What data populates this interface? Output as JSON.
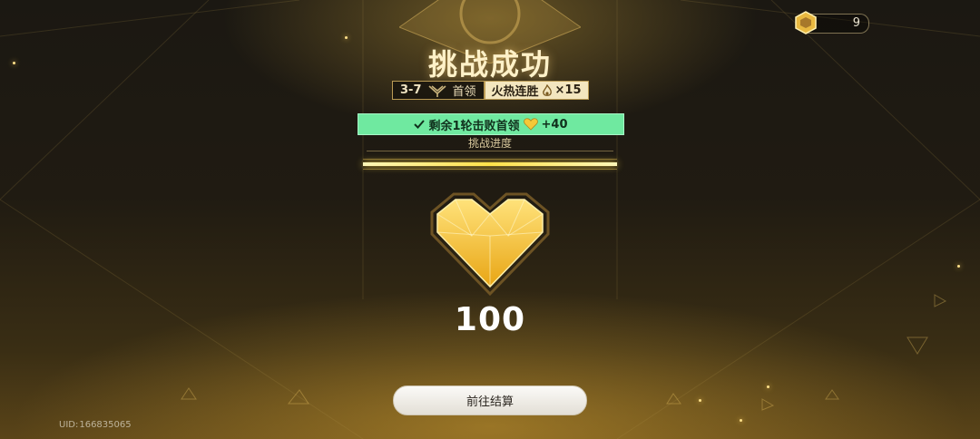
{
  "header": {
    "title": "挑战成功",
    "counter_value": "9",
    "counter_icon": "hex-gem-icon"
  },
  "stage": {
    "level": "3-7",
    "boss_label": "首领",
    "streak_label": "火热连胜",
    "streak_count": "×15"
  },
  "bonus": {
    "text": "剩余1轮击败首领",
    "reward": "+40"
  },
  "progress": {
    "label": "挑战进度",
    "fraction": 1.0
  },
  "score": {
    "value": "100"
  },
  "actions": {
    "settle_label": "前往结算"
  },
  "footer": {
    "uid_label": "UID:",
    "uid_value": "166835065"
  },
  "colors": {
    "accent_gold": "#f0c040",
    "bonus_green": "#6fe9a0",
    "title_text": "#fff1c8"
  }
}
